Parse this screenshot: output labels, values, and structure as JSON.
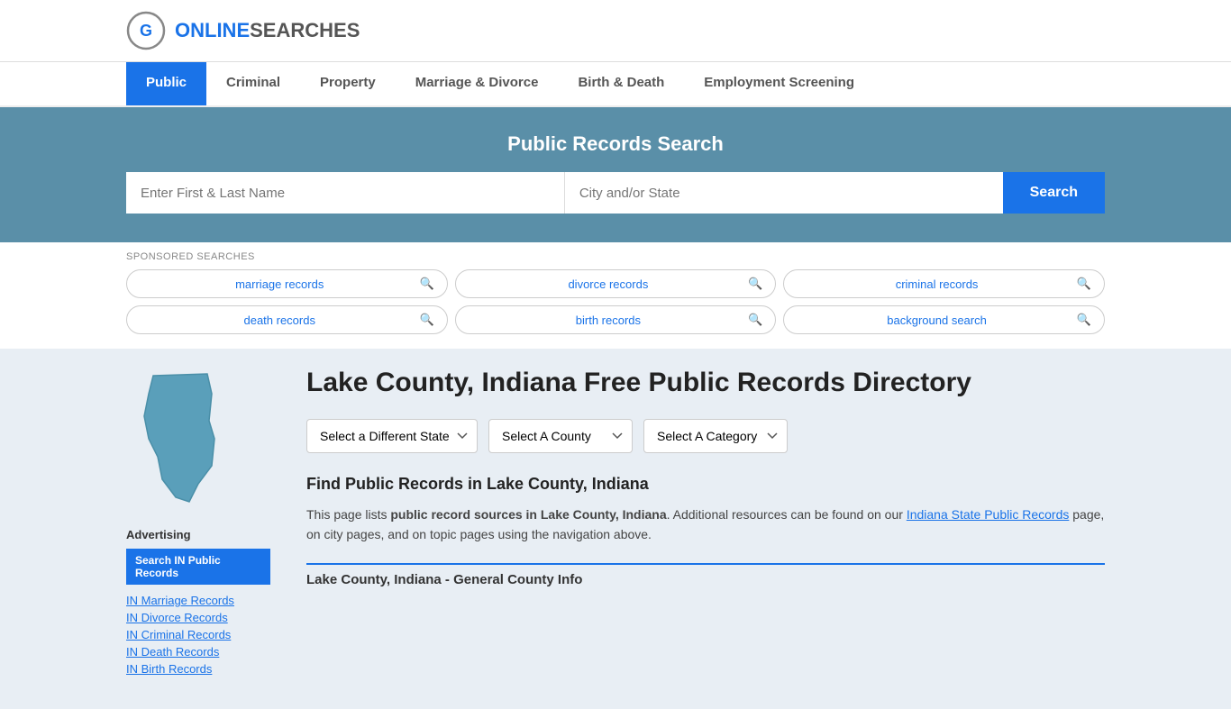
{
  "logo": {
    "text_online": "ONLINE",
    "text_searches": "SEARCHES",
    "icon_label": "online-searches-logo"
  },
  "nav": {
    "items": [
      {
        "label": "Public",
        "active": true
      },
      {
        "label": "Criminal",
        "active": false
      },
      {
        "label": "Property",
        "active": false
      },
      {
        "label": "Marriage & Divorce",
        "active": false
      },
      {
        "label": "Birth & Death",
        "active": false
      },
      {
        "label": "Employment Screening",
        "active": false
      }
    ]
  },
  "hero": {
    "title": "Public Records Search",
    "name_placeholder": "Enter First & Last Name",
    "location_placeholder": "City and/or State",
    "search_button": "Search"
  },
  "sponsored": {
    "label": "SPONSORED SEARCHES",
    "pills": [
      {
        "text": "marriage records"
      },
      {
        "text": "divorce records"
      },
      {
        "text": "criminal records"
      },
      {
        "text": "death records"
      },
      {
        "text": "birth records"
      },
      {
        "text": "background search"
      }
    ]
  },
  "page": {
    "title": "Lake County, Indiana Free Public Records Directory",
    "dropdowns": {
      "state": {
        "label": "Select a Different State"
      },
      "county": {
        "label": "Select A County"
      },
      "category": {
        "label": "Select A Category"
      }
    },
    "find_title": "Find Public Records in Lake County, Indiana",
    "find_text_1": "This page lists ",
    "find_text_bold": "public record sources in Lake County, Indiana",
    "find_text_2": ". Additional resources can be found on our ",
    "find_link": "Indiana State Public Records",
    "find_text_3": " page, on city pages, and on topic pages using the navigation above.",
    "general_info_heading": "Lake County, Indiana - General County Info"
  },
  "sidebar": {
    "advertising_label": "Advertising",
    "ad_button": "Search IN Public Records",
    "links": [
      {
        "label": "IN Marriage Records"
      },
      {
        "label": "IN Divorce Records"
      },
      {
        "label": "IN Criminal Records"
      },
      {
        "label": "IN Death Records"
      },
      {
        "label": "IN Birth Records"
      }
    ]
  },
  "colors": {
    "primary_blue": "#1a73e8",
    "hero_bg": "#5a8fa8",
    "nav_active_bg": "#1a73e8"
  }
}
